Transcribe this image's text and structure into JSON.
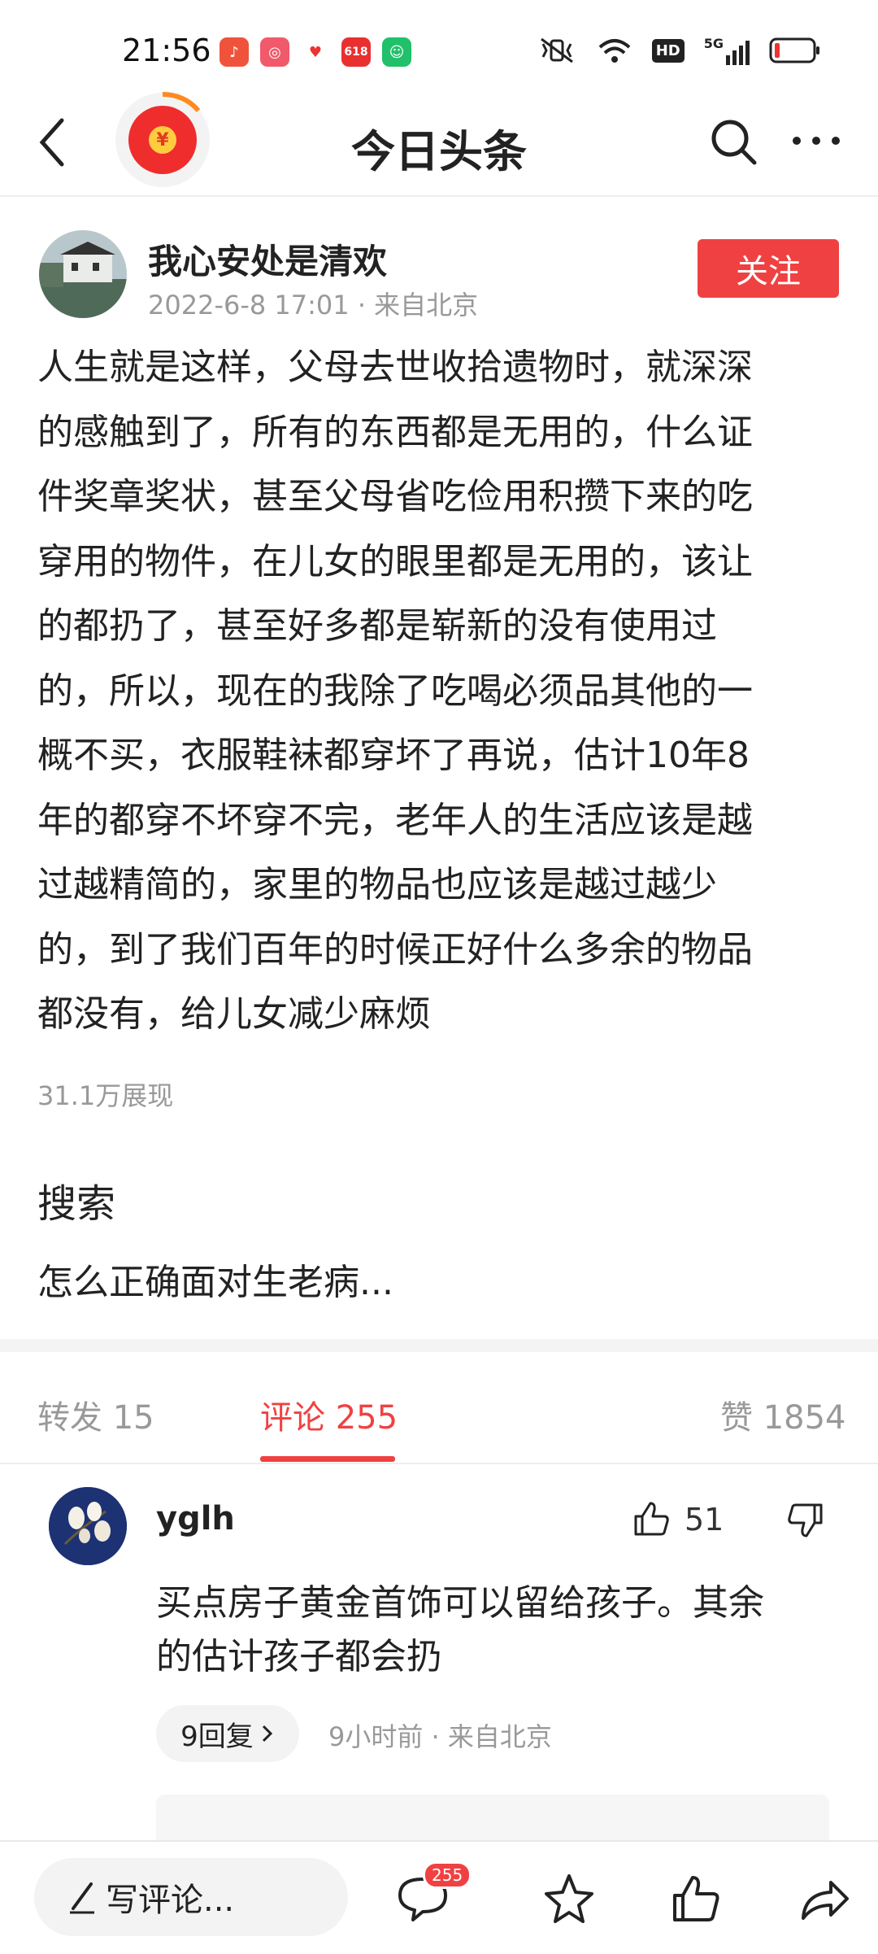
{
  "status_bar": {
    "time": "21:56",
    "apps": [
      {
        "icon": "music-app-icon",
        "color": "#f0533b",
        "glyph": "♪"
      },
      {
        "icon": "video-app-icon",
        "color": "#f05a6a",
        "glyph": "◎"
      },
      {
        "icon": "taobao-app-icon",
        "color": "#ffffff",
        "glyph": "♥"
      },
      {
        "icon": "618-app-icon",
        "color": "#e93030",
        "glyph": "618"
      },
      {
        "icon": "shopping-app-icon",
        "color": "#21c06a",
        "glyph": "☺"
      }
    ],
    "network": "5G",
    "hd": "HD"
  },
  "header": {
    "title": "今日头条",
    "coin_symbol": "¥"
  },
  "author": {
    "name": "我心安处是清欢",
    "meta": "2022-6-8 17:01 · 来自北京",
    "follow_label": "关注"
  },
  "post": {
    "lines": [
      "人生就是这样，父母去世收拾遗物时，就深深",
      "的感触到了，所有的东西都是无用的，什么证",
      "件奖章奖状，甚至父母省吃俭用积攒下来的吃",
      "穿用的物件，在儿女的眼里都是无用的，该让",
      "的都扔了，甚至好多都是崭新的没有使用过",
      "的，所以，现在的我除了吃喝必须品其他的一",
      "概不买，衣服鞋袜都穿坏了再说，估计10年8",
      "年的都穿不坏穿不完，老年人的生活应该是越",
      "过越精简的，家里的物品也应该是越过越少",
      "的，到了我们百年的时候正好什么多余的物品",
      "都没有，给儿女减少麻烦"
    ],
    "views": "31.1万展现"
  },
  "search": {
    "label": "搜索",
    "suggestion": "怎么正确面对生老病..."
  },
  "tabs": {
    "forward": "转发 15",
    "comments": "评论 255",
    "likes": "赞 1854"
  },
  "comment": {
    "user": "yglh",
    "like_count": "51",
    "text_lines": [
      "买点房子黄金首饰可以留给孩子。其余",
      "的估计孩子都会扔"
    ],
    "reply_label": "9回复",
    "meta": "9小时前 · 来自北京"
  },
  "bottom_bar": {
    "compose_placeholder": "写评论...",
    "comment_badge": "255"
  },
  "colors": {
    "accent": "#f04142",
    "muted": "#999999"
  }
}
